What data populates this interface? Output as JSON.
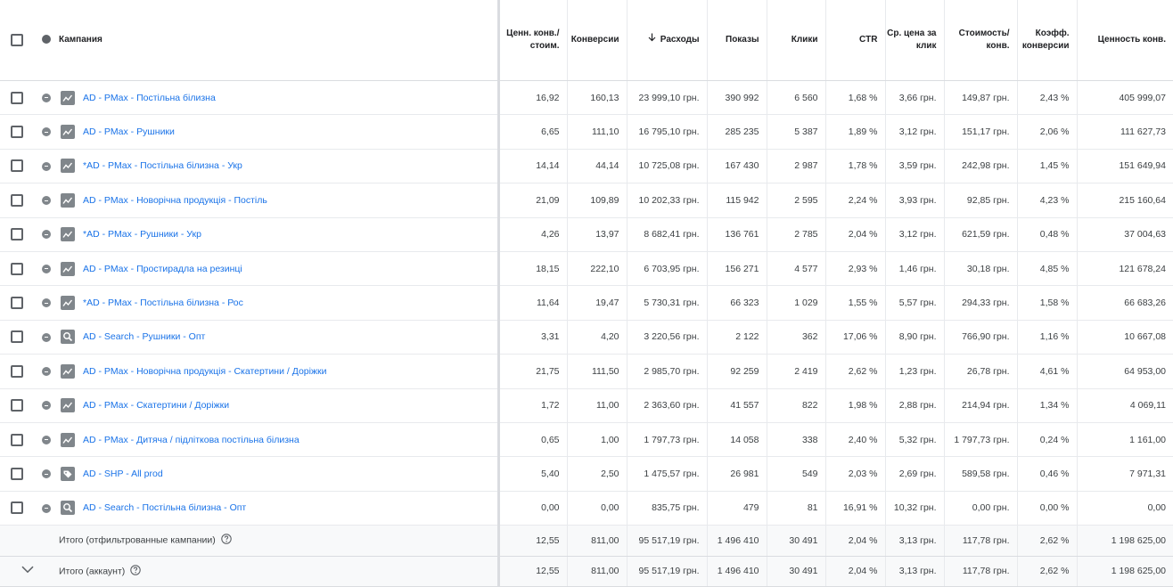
{
  "header": {
    "campaign": "Кампания",
    "columns": [
      {
        "label": "Ценн. конв./ стоим.",
        "sorted": false
      },
      {
        "label": "Конверсии",
        "sorted": false
      },
      {
        "label": "Расходы",
        "sorted": true
      },
      {
        "label": "Показы",
        "sorted": false
      },
      {
        "label": "Клики",
        "sorted": false
      },
      {
        "label": "CTR",
        "sorted": false
      },
      {
        "label": "Ср. цена за клик",
        "sorted": false
      },
      {
        "label": "Стоимость/ конв.",
        "sorted": false
      },
      {
        "label": "Коэфф. конверсии",
        "sorted": false
      },
      {
        "label": "Ценность конв.",
        "sorted": false
      }
    ]
  },
  "rows": [
    {
      "type": "pmax",
      "name": "AD - PMax - Постільна білизна",
      "values": [
        "16,92",
        "160,13",
        "23 999,10 грн.",
        "390 992",
        "6 560",
        "1,68 %",
        "3,66 грн.",
        "149,87 грн.",
        "2,43 %",
        "405 999,07"
      ]
    },
    {
      "type": "pmax",
      "name": "AD - PMax - Рушники",
      "values": [
        "6,65",
        "111,10",
        "16 795,10 грн.",
        "285 235",
        "5 387",
        "1,89 %",
        "3,12 грн.",
        "151,17 грн.",
        "2,06 %",
        "111 627,73"
      ]
    },
    {
      "type": "pmax",
      "name": "*AD - PMax - Постільна білизна - Укр",
      "values": [
        "14,14",
        "44,14",
        "10 725,08 грн.",
        "167 430",
        "2 987",
        "1,78 %",
        "3,59 грн.",
        "242,98 грн.",
        "1,45 %",
        "151 649,94"
      ]
    },
    {
      "type": "pmax",
      "name": "AD - PMax - Новорічна продукція - Постіль",
      "values": [
        "21,09",
        "109,89",
        "10 202,33 грн.",
        "115 942",
        "2 595",
        "2,24 %",
        "3,93 грн.",
        "92,85 грн.",
        "4,23 %",
        "215 160,64"
      ]
    },
    {
      "type": "pmax",
      "name": "*AD - PMax - Рушники - Укр",
      "values": [
        "4,26",
        "13,97",
        "8 682,41 грн.",
        "136 761",
        "2 785",
        "2,04 %",
        "3,12 грн.",
        "621,59 грн.",
        "0,48 %",
        "37 004,63"
      ]
    },
    {
      "type": "pmax",
      "name": "AD - PMax - Простирадла на резинці",
      "values": [
        "18,15",
        "222,10",
        "6 703,95 грн.",
        "156 271",
        "4 577",
        "2,93 %",
        "1,46 грн.",
        "30,18 грн.",
        "4,85 %",
        "121 678,24"
      ]
    },
    {
      "type": "pmax",
      "name": "*AD - PMax - Постільна білизна - Рос",
      "values": [
        "11,64",
        "19,47",
        "5 730,31 грн.",
        "66 323",
        "1 029",
        "1,55 %",
        "5,57 грн.",
        "294,33 грн.",
        "1,58 %",
        "66 683,26"
      ]
    },
    {
      "type": "search",
      "name": "AD - Search - Рушники - Опт",
      "values": [
        "3,31",
        "4,20",
        "3 220,56 грн.",
        "2 122",
        "362",
        "17,06 %",
        "8,90 грн.",
        "766,90 грн.",
        "1,16 %",
        "10 667,08"
      ]
    },
    {
      "type": "pmax",
      "name": "AD - PMax - Новорічна продукція - Скатертини / Доріжки",
      "values": [
        "21,75",
        "111,50",
        "2 985,70 грн.",
        "92 259",
        "2 419",
        "2,62 %",
        "1,23 грн.",
        "26,78 грн.",
        "4,61 %",
        "64 953,00"
      ]
    },
    {
      "type": "pmax",
      "name": "AD - PMax - Скатертини / Доріжки",
      "values": [
        "1,72",
        "11,00",
        "2 363,60 грн.",
        "41 557",
        "822",
        "1,98 %",
        "2,88 грн.",
        "214,94 грн.",
        "1,34 %",
        "4 069,11"
      ]
    },
    {
      "type": "pmax",
      "name": "AD - PMax - Дитяча / підліткова постільна білизна",
      "values": [
        "0,65",
        "1,00",
        "1 797,73 грн.",
        "14 058",
        "338",
        "2,40 %",
        "5,32 грн.",
        "1 797,73 грн.",
        "0,24 %",
        "1 161,00"
      ]
    },
    {
      "type": "shopping",
      "name": "AD - SHP - All prod",
      "values": [
        "5,40",
        "2,50",
        "1 475,57 грн.",
        "26 981",
        "549",
        "2,03 %",
        "2,69 грн.",
        "589,58 грн.",
        "0,46 %",
        "7 971,31"
      ]
    },
    {
      "type": "search",
      "name": "AD - Search - Постільна білизна - Опт",
      "values": [
        "0,00",
        "0,00",
        "835,75 грн.",
        "479",
        "81",
        "16,91 %",
        "10,32 грн.",
        "0,00 грн.",
        "0,00 %",
        "0,00"
      ]
    }
  ],
  "totals": [
    {
      "label": "Итого (отфильтрованные кампании)",
      "expandable": false,
      "values": [
        "12,55",
        "811,00",
        "95 517,19 грн.",
        "1 496 410",
        "30 491",
        "2,04 %",
        "3,13 грн.",
        "117,78 грн.",
        "2,62 %",
        "1 198 625,00"
      ]
    },
    {
      "label": "Итого (аккаунт)",
      "expandable": true,
      "values": [
        "12,55",
        "811,00",
        "95 517,19 грн.",
        "1 496 410",
        "30 491",
        "2,04 %",
        "3,13 грн.",
        "117,78 грн.",
        "2,62 %",
        "1 198 625,00"
      ]
    }
  ]
}
